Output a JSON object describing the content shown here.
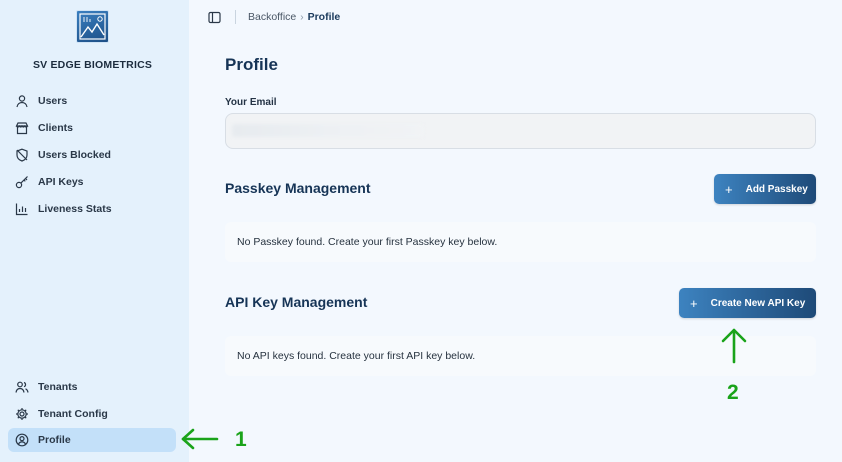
{
  "brand": {
    "name": "SV EDGE BIOMETRICS"
  },
  "sidebar": {
    "items": [
      {
        "label": "Users",
        "icon": "user-icon"
      },
      {
        "label": "Clients",
        "icon": "store-icon"
      },
      {
        "label": "Users Blocked",
        "icon": "shield-off-icon"
      },
      {
        "label": "API Keys",
        "icon": "key-icon"
      },
      {
        "label": "Liveness Stats",
        "icon": "bar-chart-icon"
      }
    ],
    "bottom_items": [
      {
        "label": "Tenants",
        "icon": "users-icon"
      },
      {
        "label": "Tenant Config",
        "icon": "gear-icon"
      },
      {
        "label": "Profile",
        "icon": "user-circle-icon",
        "active": true
      }
    ]
  },
  "breadcrumb": {
    "parent": "Backoffice",
    "current": "Profile"
  },
  "main": {
    "title": "Profile",
    "email_label": "Your Email",
    "email_value": "",
    "passkey": {
      "title": "Passkey Management",
      "button_label": "Add Passkey",
      "empty_text": "No Passkey found. Create your first Passkey key below."
    },
    "api_keys": {
      "title": "API Key Management",
      "button_label": "Create New API Key",
      "empty_text": "No API keys found. Create your first API key below."
    }
  },
  "annotations": {
    "arrow1_label": "1",
    "arrow2_label": "2"
  },
  "colors": {
    "sidebar_bg": "#e4f1fc",
    "active_item": "#c3e0f9",
    "primary_button": "#1e4a78",
    "annotation": "#1aa31a"
  }
}
